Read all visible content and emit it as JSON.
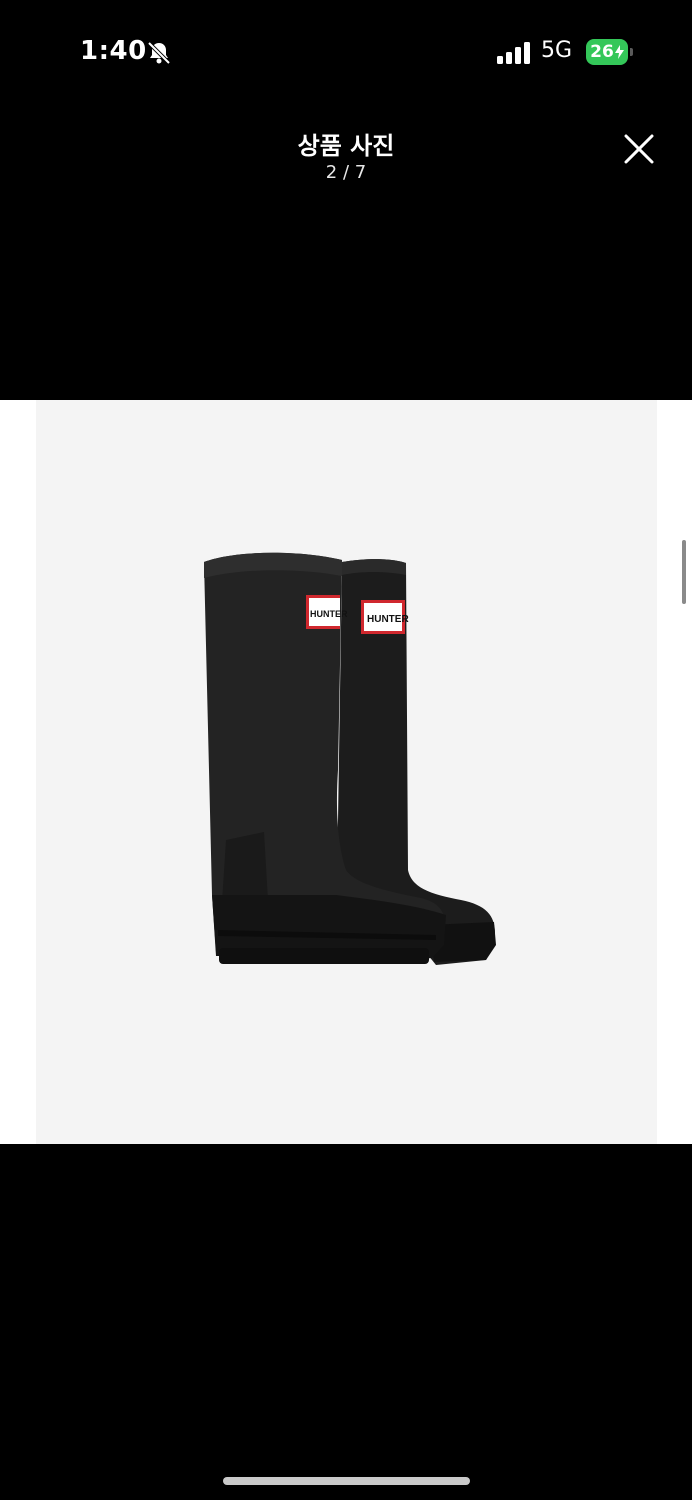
{
  "status_bar": {
    "time": "1:40",
    "network": "5G",
    "battery_level": "26",
    "battery_color": "#34c759"
  },
  "header": {
    "title": "상품 사진",
    "counter": "2 / 7",
    "close_icon": "close-icon"
  },
  "product_image": {
    "description_icon": "rain-boots-image",
    "brand_label": "HUNTER"
  },
  "colors": {
    "background": "#000000",
    "photo_background": "#f4f4f4",
    "boot": "#1f1f1f",
    "label_red": "#d0282e"
  }
}
